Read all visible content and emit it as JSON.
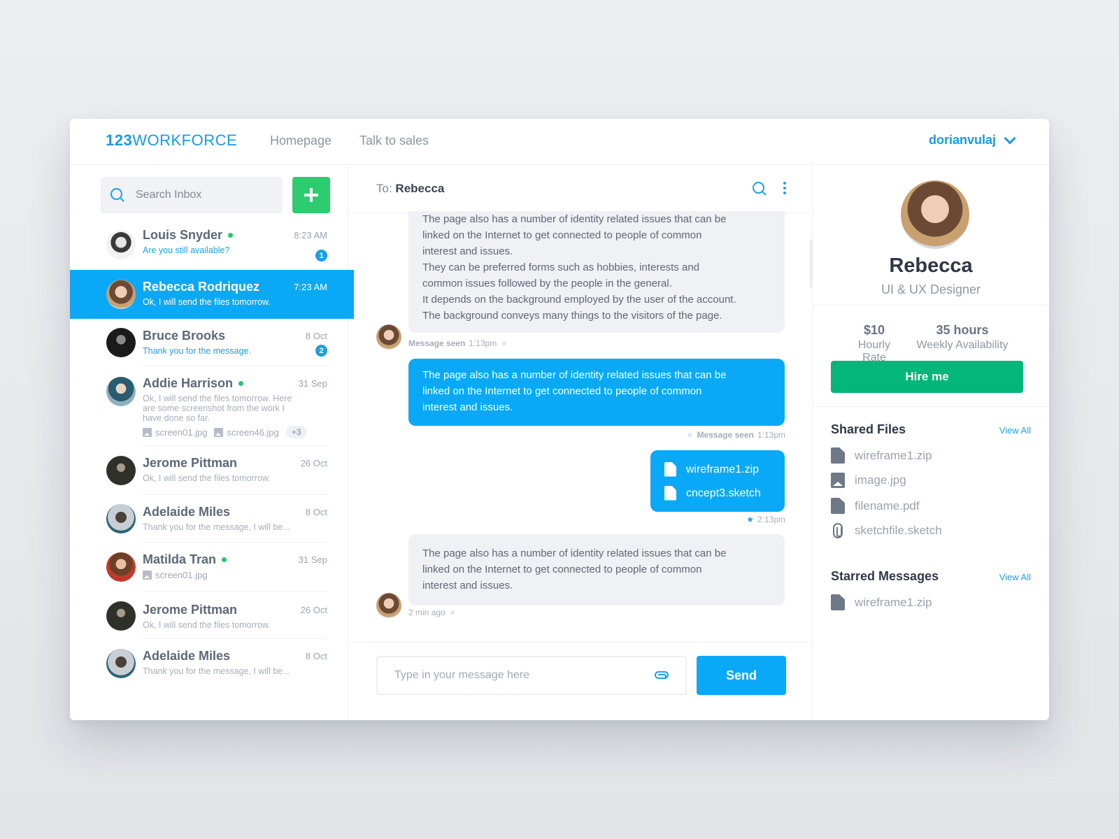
{
  "header": {
    "logo_bold": "123",
    "logo_rest": "WORKFORCE",
    "nav": [
      {
        "label": "Homepage"
      },
      {
        "label": "Talk to sales"
      }
    ],
    "username": "dorianvulaj"
  },
  "inbox": {
    "search_placeholder": "Search Inbox",
    "add_icon": "plus-icon",
    "conversations": [
      {
        "name": "Louis Snyder",
        "online": true,
        "time": "8:23 AM",
        "preview": "Are you still available?",
        "unread": 1
      },
      {
        "name": "Rebecca Rodriquez",
        "online": false,
        "time": "7:23 AM",
        "preview": "Ok, I will send the files tomorrow.",
        "active": true
      },
      {
        "name": "Bruce Brooks",
        "online": false,
        "time": "8 Oct",
        "preview": "Thank you for the message.",
        "unread": 2
      },
      {
        "name": "Addie Harrison",
        "online": true,
        "time": "31 Sep",
        "preview": "Ok, I will send the files tomorrow. Here are some screenshot from the work I have done so far.",
        "attachments": [
          "screen01.jpg",
          "screen46.jpg"
        ],
        "more": "+3"
      },
      {
        "name": "Jerome Pittman",
        "online": false,
        "time": "26 Oct",
        "preview": "Ok, I will send the files tomorrow."
      },
      {
        "name": "Adelaide Miles",
        "online": false,
        "time": "8 Oct",
        "preview": "Thank you for the message, I will be..."
      },
      {
        "name": "Matilda Tran",
        "online": true,
        "time": "31 Sep",
        "attachments": [
          "screen01.jpg"
        ]
      },
      {
        "name": "Jerome Pittman",
        "online": false,
        "time": "26 Oct",
        "preview": "Ok, I will send the files tomorrow."
      },
      {
        "name": "Adelaide Miles",
        "online": false,
        "time": "8 Oct",
        "preview": "Thank you for the message, I will be..."
      }
    ]
  },
  "chat": {
    "to_label": "To:",
    "to_name": "Rebecca",
    "messages": [
      {
        "direction": "in",
        "lines": [
          "The page also has a number of identity related issues that can be",
          "linked on the Internet to get connected to people of common",
          "interest and issues.",
          "They can be preferred forms such as hobbies, interests and",
          "common issues followed by the people in the general.",
          "It depends on the background employed by the user of the account.",
          "The background conveys many things to the visitors of the page."
        ],
        "status": "Message seen",
        "time": "1:13pm",
        "starred": false
      },
      {
        "direction": "out",
        "lines": [
          "The page also has a number of identity related issues that can be",
          "linked on the Internet to get connected to people of common",
          "interest and issues."
        ],
        "status": "Message seen",
        "time": "1:13pm",
        "starred": false
      },
      {
        "direction": "out",
        "files": [
          "wireframe1.zip",
          "cncept3.sketch"
        ],
        "time": "2:13pm",
        "starred": true
      },
      {
        "direction": "in",
        "lines": [
          "The page also has a number of identity related issues that can be",
          "linked on the Internet to get connected to people of common",
          "interest and issues."
        ],
        "time": "2 min ago",
        "starred": false
      }
    ],
    "composer_placeholder": "Type in your message here",
    "send_label": "Send"
  },
  "profile": {
    "name": "Rebecca",
    "role": "UI & UX Designer",
    "rate_value": "$10",
    "rate_label": "Hourly Rate",
    "availability_value": "35 hours",
    "availability_label": "Weekly Availability",
    "hire_label": "Hire me",
    "shared_files_title": "Shared Files",
    "shared_view_all": "View All",
    "shared_files": [
      {
        "name": "wireframe1.zip",
        "icon": "file-icon"
      },
      {
        "name": "image.jpg",
        "icon": "image-icon"
      },
      {
        "name": "filename.pdf",
        "icon": "file-icon"
      },
      {
        "name": "sketchfile.sketch",
        "icon": "paperclip-icon"
      }
    ],
    "starred_title": "Starred Messages",
    "starred_view_all": "View All",
    "starred_files": [
      {
        "name": "wireframe1.zip",
        "icon": "file-icon"
      }
    ]
  },
  "colors": {
    "brand": "#1a9ae0",
    "accent": "#0aa9f7",
    "success": "#2ecc71",
    "hire": "#03b67a"
  }
}
